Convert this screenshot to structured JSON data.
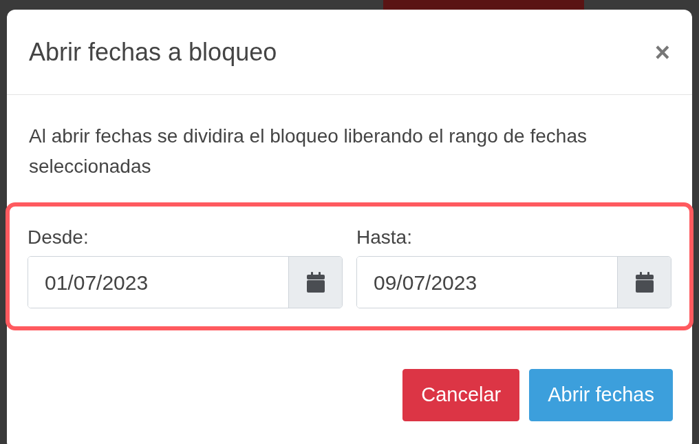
{
  "dialog": {
    "title": "Abrir fechas a bloqueo",
    "close": "×",
    "message": "Al abrir fechas se dividira el bloqueo liberando el rango de fechas seleccionadas",
    "fields": [
      {
        "label": "Desde:",
        "value": "01/07/2023"
      },
      {
        "label": "Hasta:",
        "value": "09/07/2023"
      }
    ],
    "buttons": [
      {
        "label": "Cancelar",
        "kind": "danger"
      },
      {
        "label": "Abrir fechas",
        "kind": "primary"
      }
    ]
  }
}
